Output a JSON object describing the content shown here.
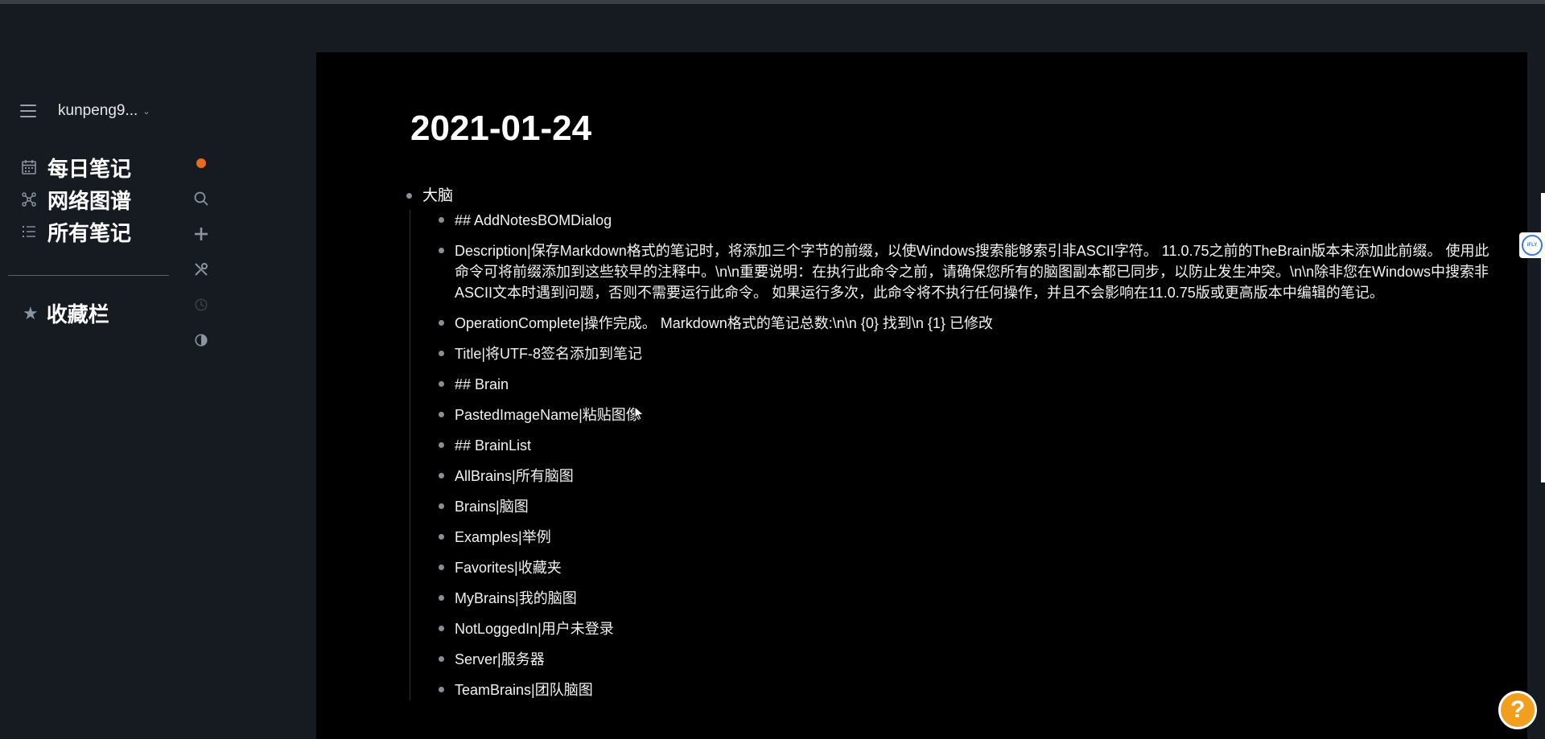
{
  "sidebar": {
    "graph_name": "kunpeng9...",
    "nav": [
      {
        "label": "每日笔记",
        "icon": "calendar-icon"
      },
      {
        "label": "网络图谱",
        "icon": "graph-icon"
      },
      {
        "label": "所有笔记",
        "icon": "list-icon"
      }
    ],
    "favorites_label": "收藏栏",
    "tools": [
      "notification-dot",
      "search-icon",
      "add-icon",
      "tools-icon",
      "history-icon",
      "theme-toggle-icon"
    ]
  },
  "page": {
    "title": "2021-01-24",
    "root_block": "大脑",
    "children": [
      "## AddNotesBOMDialog",
      "Description|保存Markdown格式的笔记时，将添加三个字节的前缀，以使Windows搜索能够索引非ASCII字符。 11.0.75之前的TheBrain版本未添加此前缀。 使用此命令可将前缀添加到这些较早的注释中。\\n\\n重要说明：在执行此命令之前，请确保您所有的脑图副本都已同步，以防止发生冲突。\\n\\n除非您在Windows中搜索非ASCII文本时遇到问题，否则不需要运行此命令。 如果运行多次，此命令将不执行任何操作，并且不会影响在11.0.75版或更高版本中编辑的笔记。",
      "OperationComplete|操作完成。 Markdown格式的笔记总数:\\n\\n {0} 找到\\n {1} 已修改",
      "Title|将UTF-8签名添加到笔记",
      "## Brain",
      "PastedImageName|粘贴图像",
      "## BrainList",
      "AllBrains|所有脑图",
      "Brains|脑图",
      "Examples|举例",
      "Favorites|收藏夹",
      "MyBrains|我的脑图",
      "NotLoggedIn|用户未登录",
      "Server|服务器",
      "TeamBrains|团队脑图"
    ]
  },
  "overlay": {
    "ifly_label": "iFLY",
    "help_label": "?"
  },
  "colors": {
    "accent_dot": "#e86a1f",
    "help_button": "#f29f1f",
    "main_bg": "#000000",
    "sidebar_bg": "#161b22"
  }
}
